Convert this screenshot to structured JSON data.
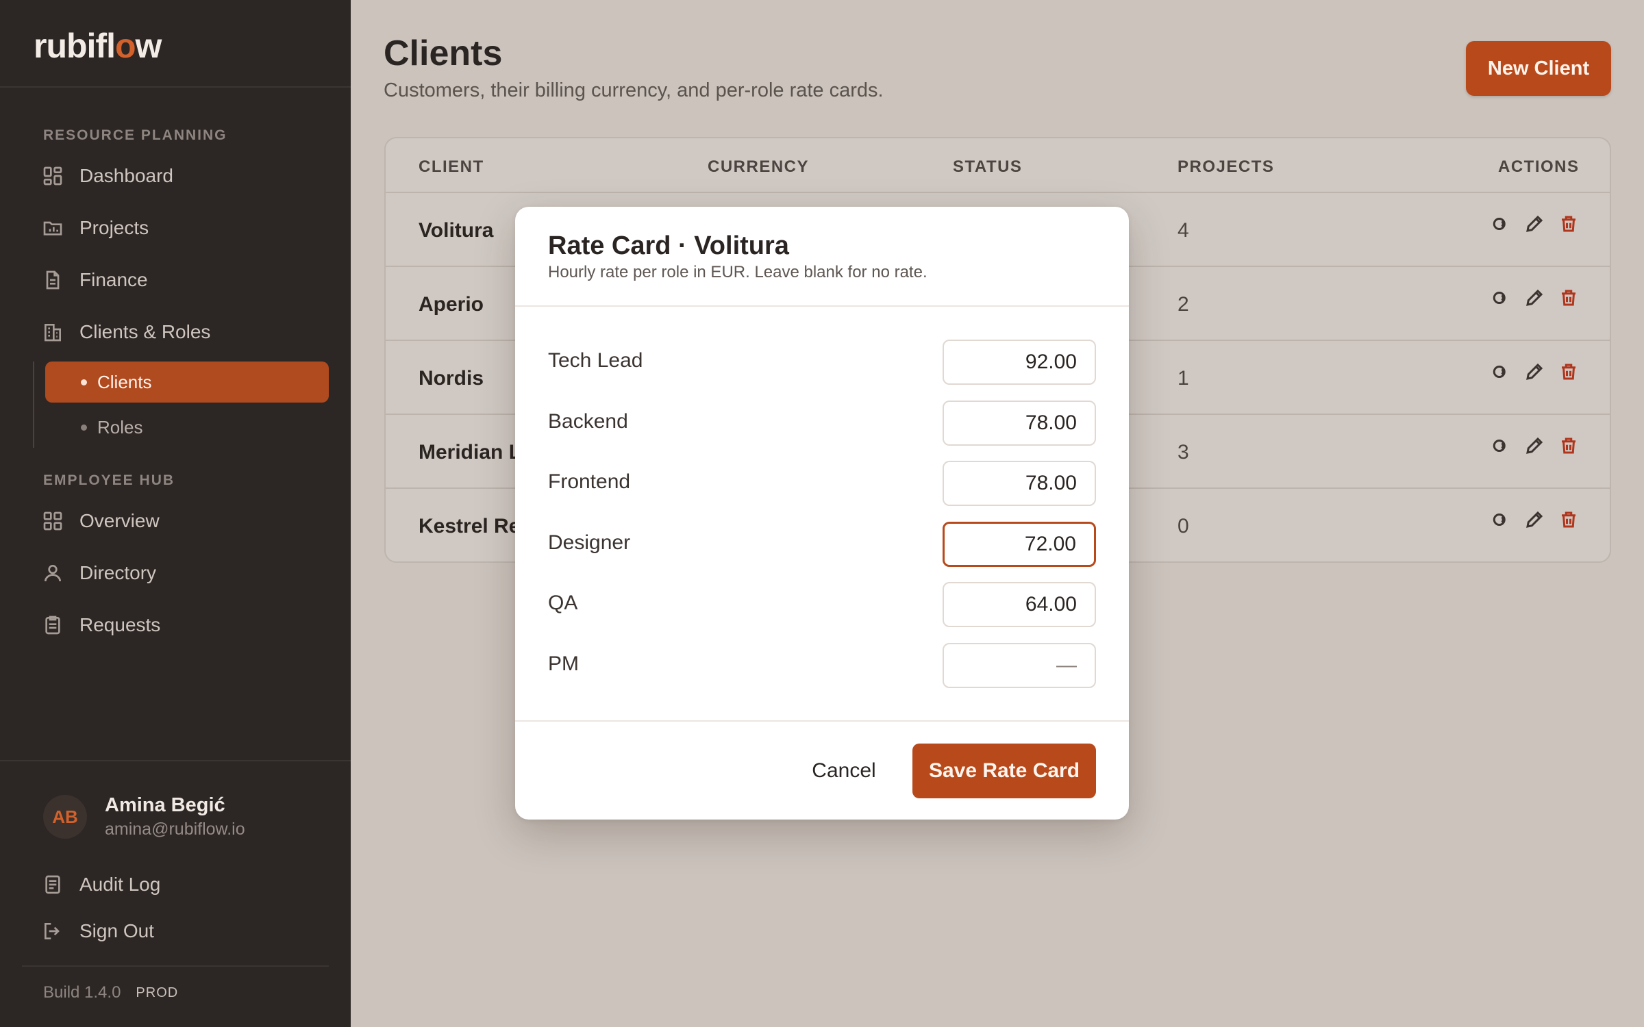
{
  "brand": {
    "logo_start": "rubifl",
    "logo_accent": "o",
    "logo_end": "w"
  },
  "sidebar": {
    "section_resource": "RESOURCE PLANNING",
    "section_employee": "EMPLOYEE HUB",
    "items": [
      {
        "label": "Dashboard",
        "icon": "grid-icon"
      },
      {
        "label": "Projects",
        "icon": "folder-chart-icon"
      },
      {
        "label": "Finance",
        "icon": "document-icon"
      },
      {
        "label": "Clients & Roles",
        "icon": "building-icon"
      }
    ],
    "sub_items": [
      {
        "label": "Clients",
        "active": true
      },
      {
        "label": "Roles",
        "active": false
      }
    ],
    "employee_items": [
      {
        "label": "Overview",
        "icon": "grid-icon"
      },
      {
        "label": "Directory",
        "icon": "user-icon"
      },
      {
        "label": "Requests",
        "icon": "clipboard-icon"
      }
    ],
    "user": {
      "initials": "AB",
      "name": "Amina Begić",
      "email": "amina@rubiflow.io"
    },
    "footer_items": [
      {
        "label": "Audit Log",
        "icon": "log-icon"
      },
      {
        "label": "Sign Out",
        "icon": "sign-out-icon"
      }
    ],
    "build": "Build 1.4.0",
    "env": "PROD"
  },
  "main": {
    "title": "Clients",
    "subtitle": "Customers, their billing currency, and per-role rate cards.",
    "new_button": "New Client",
    "table": {
      "headers": {
        "client": "CLIENT",
        "currency": "CURRENCY",
        "status": "STATUS",
        "projects": "PROJECTS",
        "actions": "ACTIONS"
      },
      "rows": [
        {
          "client": "Volitura",
          "projects": "4"
        },
        {
          "client": "Aperio",
          "projects": "2"
        },
        {
          "client": "Nordis",
          "projects": "1"
        },
        {
          "client": "Meridian La",
          "projects": "3"
        },
        {
          "client": "Kestrel Ret",
          "projects": "0"
        }
      ]
    }
  },
  "modal": {
    "title": "Rate Card · Volitura",
    "description": "Hourly rate per role in EUR. Leave blank for no rate.",
    "rates": [
      {
        "role": "Tech Lead",
        "value": "92.00"
      },
      {
        "role": "Backend",
        "value": "78.00"
      },
      {
        "role": "Frontend",
        "value": "78.00"
      },
      {
        "role": "Designer",
        "value": "72.00"
      },
      {
        "role": "QA",
        "value": "64.00"
      },
      {
        "role": "PM",
        "value": "",
        "placeholder": "—"
      }
    ],
    "cancel_label": "Cancel",
    "save_label": "Save Rate Card"
  },
  "colors": {
    "accent": "#b8491b",
    "sidebar_bg": "#2c2624",
    "page_bg": "#cbc3bc"
  }
}
